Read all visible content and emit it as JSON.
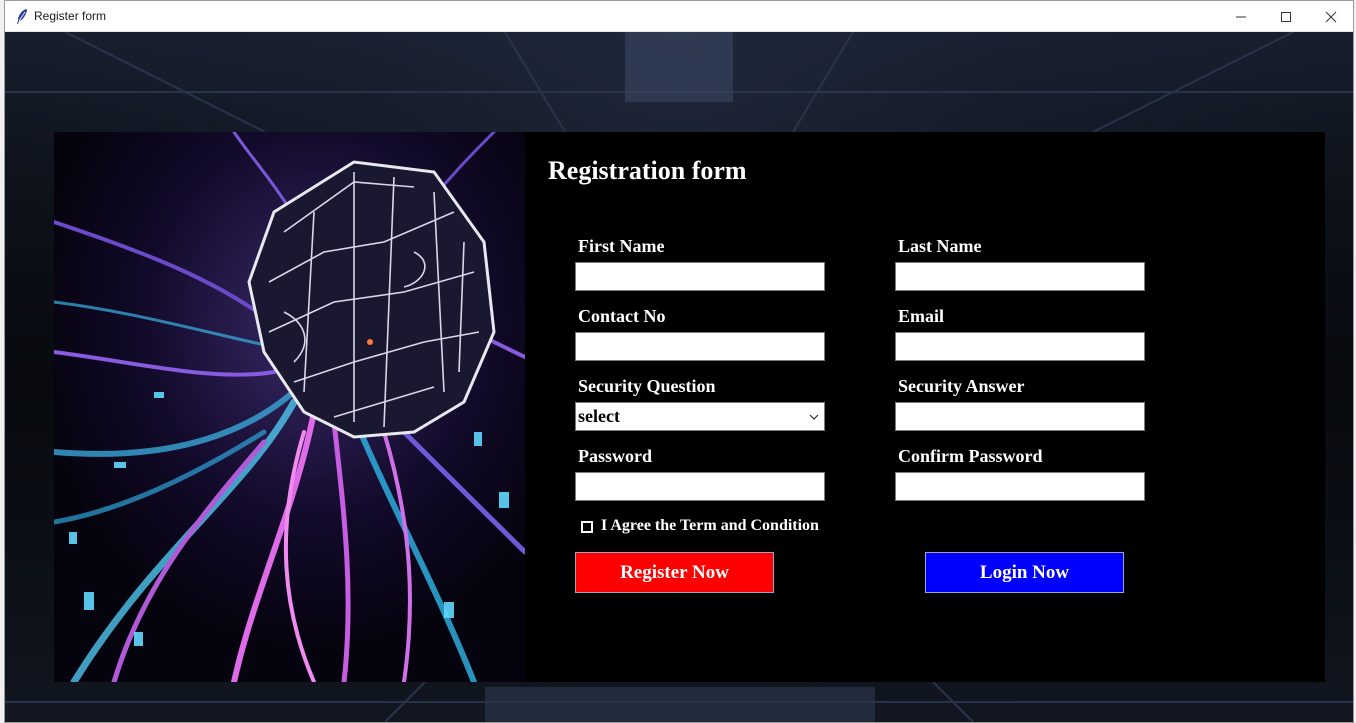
{
  "window": {
    "title": "Register form",
    "icon": "feather-icon",
    "controls": [
      "minimize-icon",
      "maximize-icon",
      "close-icon"
    ]
  },
  "form": {
    "title": "Registration form",
    "fields": {
      "first_name": {
        "label": "First Name",
        "value": ""
      },
      "last_name": {
        "label": "Last Name",
        "value": ""
      },
      "contact_no": {
        "label": "Contact No",
        "value": ""
      },
      "email": {
        "label": "Email",
        "value": ""
      },
      "security_question": {
        "label": "Security Question",
        "value": "select"
      },
      "security_answer": {
        "label": "Security Answer",
        "value": ""
      },
      "password": {
        "label": "Password",
        "value": ""
      },
      "confirm_password": {
        "label": "Confirm Password",
        "value": ""
      }
    },
    "agree_label": "I Agree the Term and Condition",
    "register_label": "Register Now",
    "login_label": "Login Now"
  },
  "colors": {
    "panel_background": "#000000",
    "register_button": "#ff0000",
    "login_button": "#0000ff",
    "text": "#ffffff"
  }
}
